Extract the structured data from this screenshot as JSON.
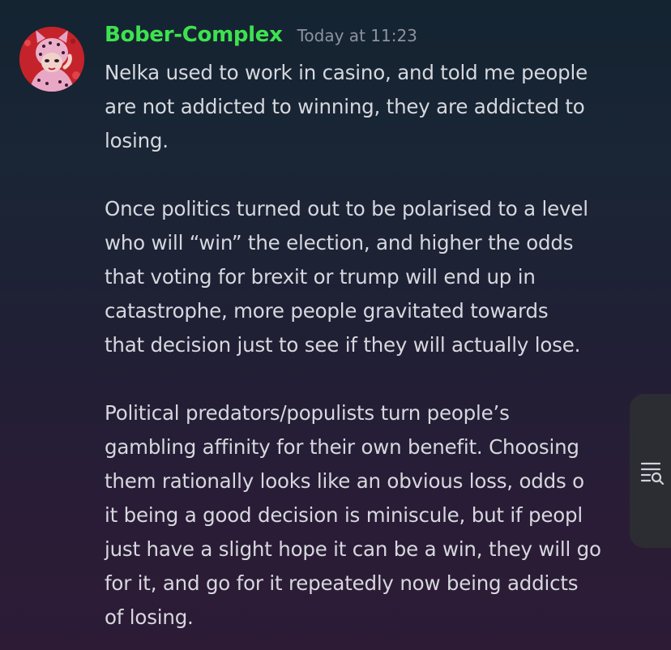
{
  "message": {
    "author": "Bober-Complex",
    "timestamp": "Today at 11:23",
    "author_color": "#3ee24f",
    "paragraphs": [
      [
        "Nelka used to work in casino, and told me people",
        "are not addicted to winning, they are addicted to",
        "losing."
      ],
      [
        "Once politics turned out to be polarised to a level",
        "who will “win” the election, and higher the odds",
        "that voting for brexit or trump will end up in",
        "catastrophe, more people gravitated towards",
        "that decision just to see if they will actually lose."
      ],
      [
        "Political predators/populists turn people’s",
        "gambling affinity for their own benefit. Choosing",
        "them rationally looks like an obvious loss, odds o",
        "it being a good decision is miniscule, but if peopl",
        "just have a slight hope it can be a win, they will go",
        "for it, and go for it repeatedly now being addicts",
        "of losing."
      ]
    ]
  },
  "side_panel": {
    "icon": "search-list-icon"
  }
}
